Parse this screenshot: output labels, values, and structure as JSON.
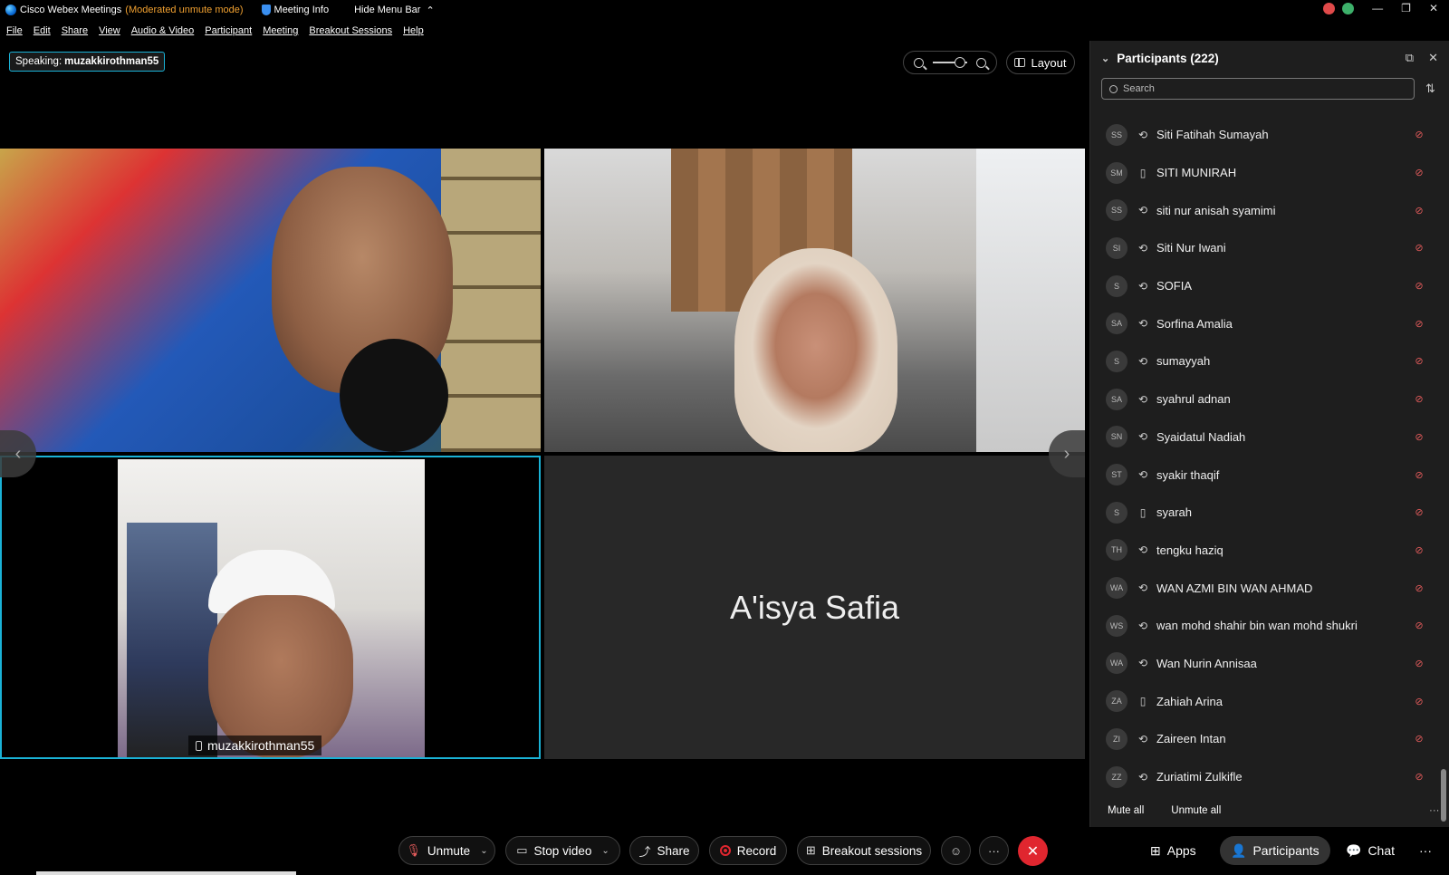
{
  "titlebar": {
    "app_title": "Cisco Webex Meetings",
    "mode": "(Moderated unmute mode)",
    "meeting_info": "Meeting Info",
    "hide_menu": "Hide Menu Bar"
  },
  "menu": [
    "File",
    "Edit",
    "Share",
    "View",
    "Audio & Video",
    "Participant",
    "Meeting",
    "Breakout Sessions",
    "Help"
  ],
  "speaking": {
    "label": "Speaking:",
    "name": "muzakkirothman55"
  },
  "layout_button": "Layout",
  "videos": {
    "tile3_name": "muzakkirothman55",
    "tile4_name": "A'isya Safia"
  },
  "participants_panel": {
    "title": "Participants (222)",
    "search_placeholder": "Search",
    "items": [
      {
        "initials": "SS",
        "name": "Siti Fatihah Sumayah",
        "device": "sync"
      },
      {
        "initials": "SM",
        "name": "SITI MUNIRAH",
        "device": "phone"
      },
      {
        "initials": "SS",
        "name": "siti nur anisah syamimi",
        "device": "sync"
      },
      {
        "initials": "SI",
        "name": "Siti Nur Iwani",
        "device": "sync"
      },
      {
        "initials": "S",
        "name": "SOFIA",
        "device": "sync"
      },
      {
        "initials": "SA",
        "name": "Sorfina Amalia",
        "device": "sync"
      },
      {
        "initials": "S",
        "name": "sumayyah",
        "device": "sync"
      },
      {
        "initials": "SA",
        "name": "syahrul adnan",
        "device": "sync"
      },
      {
        "initials": "SN",
        "name": "Syaidatul Nadiah",
        "device": "sync"
      },
      {
        "initials": "ST",
        "name": "syakir thaqif",
        "device": "sync"
      },
      {
        "initials": "S",
        "name": "syarah",
        "device": "phone"
      },
      {
        "initials": "TH",
        "name": "tengku haziq",
        "device": "sync"
      },
      {
        "initials": "WA",
        "name": "WAN AZMI BIN WAN AHMAD",
        "device": "sync"
      },
      {
        "initials": "WS",
        "name": "wan mohd shahir bin wan mohd shukri",
        "device": "sync"
      },
      {
        "initials": "WA",
        "name": "Wan Nurin Annisaa",
        "device": "sync"
      },
      {
        "initials": "ZA",
        "name": "Zahiah Arina",
        "device": "phone"
      },
      {
        "initials": "ZI",
        "name": "Zaireen Intan",
        "device": "sync"
      },
      {
        "initials": "ZZ",
        "name": "Zuriatimi Zulkifle",
        "device": "sync"
      }
    ],
    "mute_all": "Mute all",
    "unmute_all": "Unmute all"
  },
  "controls": {
    "unmute": "Unmute",
    "stop_video": "Stop video",
    "share": "Share",
    "record": "Record",
    "breakout": "Breakout sessions",
    "apps": "Apps",
    "participants": "Participants",
    "chat": "Chat"
  },
  "colors": {
    "accent": "#1ab2d6",
    "end_call": "#e0262f",
    "moderated": "#f0a030"
  }
}
